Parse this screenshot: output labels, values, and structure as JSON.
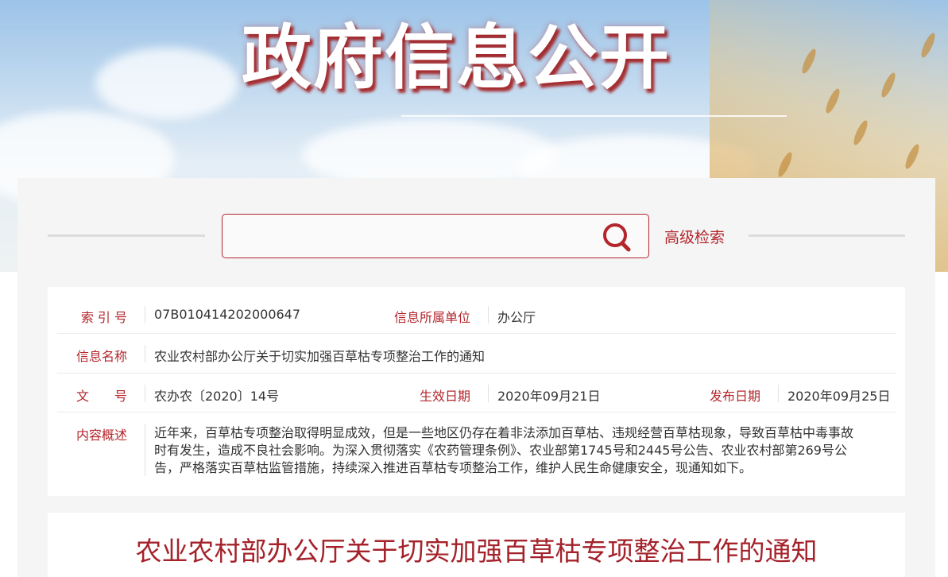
{
  "banner": {
    "title": "政府信息公开"
  },
  "search": {
    "placeholder": "",
    "advanced_label": "高级检索"
  },
  "info": {
    "index_label": "索 引 号",
    "index_value": "07B010414202000647",
    "unit_label": "信息所属单位",
    "unit_value": "办公厅",
    "name_label": "信息名称",
    "name_value": "农业农村部办公厅关于切实加强百草枯专项整治工作的通知",
    "doc_label": "文　　号",
    "doc_value": "农办农〔2020〕14号",
    "effective_label": "生效日期",
    "effective_value": "2020年09月21日",
    "publish_label": "发布日期",
    "publish_value": "2020年09月25日",
    "summary_label": "内容概述",
    "summary_line1": "近年来，百草枯专项整治取得明显成效，但是一些地区仍存在着非法添加百草枯、违规经营百草枯现象，导致百草枯中毒事故",
    "summary_line2": "时有发生，造成不良社会影响。为深入贯彻落实《农药管理条例》、农业部第1745号和2445号公告、农业农村部第269号公",
    "summary_line3": "告，严格落实百草枯监管措施，持续深入推进百草枯专项整治工作，维护人民生命健康安全，现通知如下。"
  },
  "article": {
    "title": "农业农村部办公厅关于切实加强百草枯专项整治工作的通知"
  },
  "colors": {
    "accent": "#b3262c",
    "panel_bg": "#f5f5f5",
    "text": "#333333"
  }
}
